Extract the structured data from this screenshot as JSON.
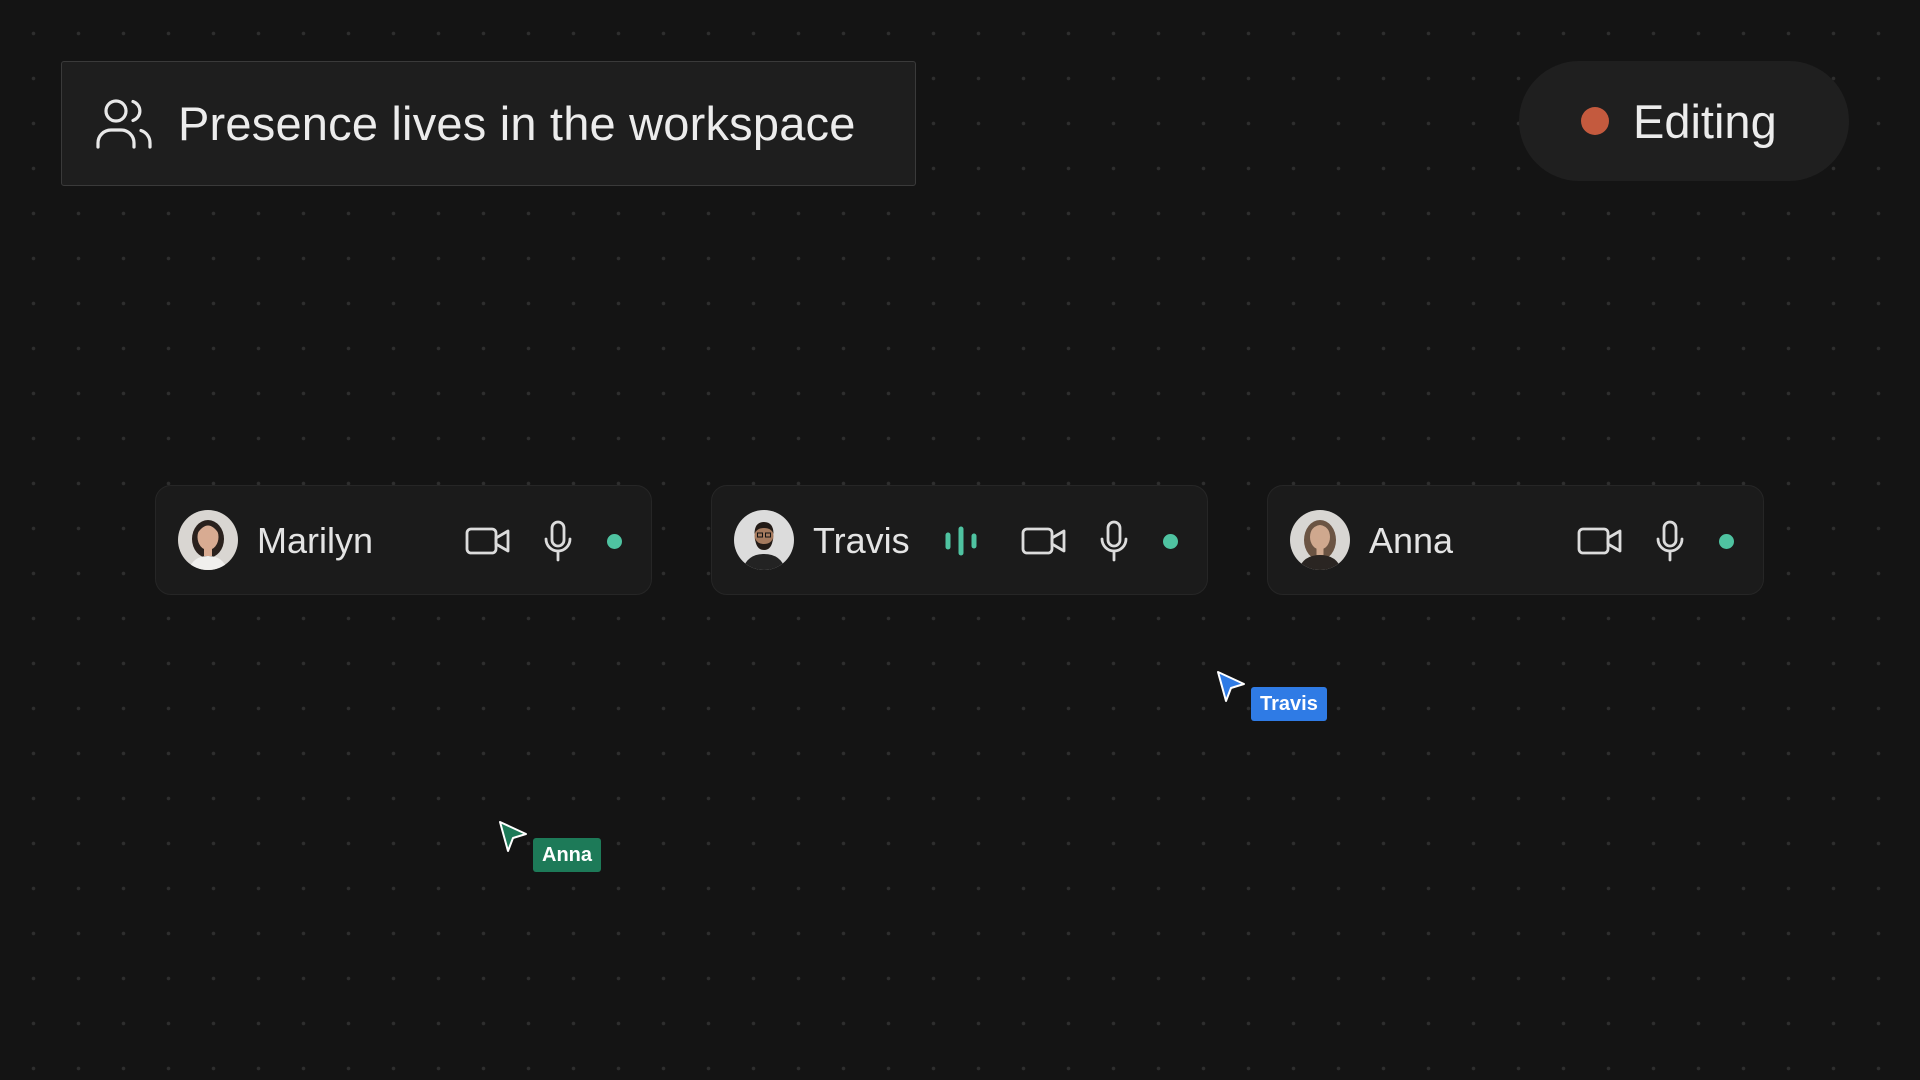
{
  "header": {
    "title": "Presence lives in the workspace",
    "icon": "users-icon"
  },
  "status": {
    "label": "Editing",
    "color": "#c45a3e"
  },
  "participants": [
    {
      "name": "Marilyn",
      "speaking": false,
      "online": true,
      "controls": [
        "video-icon",
        "mic-icon"
      ]
    },
    {
      "name": "Travis",
      "speaking": true,
      "online": true,
      "controls": [
        "audio-wave-icon",
        "video-icon",
        "mic-icon"
      ]
    },
    {
      "name": "Anna",
      "speaking": false,
      "online": true,
      "controls": [
        "video-icon",
        "mic-icon"
      ]
    }
  ],
  "cursors": [
    {
      "name": "Travis",
      "color": "#2f7be5"
    },
    {
      "name": "Anna",
      "color": "#1d7a58"
    }
  ],
  "colors": {
    "background": "#141414",
    "online": "#4fc3a1",
    "speaking": "#4fc3a1"
  }
}
